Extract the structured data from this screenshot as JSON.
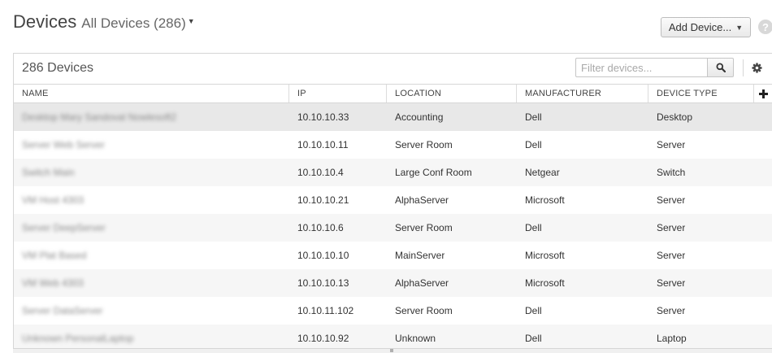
{
  "header": {
    "title": "Devices",
    "view_label": "All Devices (286)",
    "add_button": "Add Device...",
    "help_glyph": "?"
  },
  "toolbar": {
    "count_label": "286 Devices",
    "filter_placeholder": "Filter devices..."
  },
  "columns": [
    "NAME",
    "IP",
    "LOCATION",
    "MANUFACTURER",
    "DEVICE TYPE"
  ],
  "rows": [
    {
      "name": "Desktop Mary Sandoval Nowlesoft2",
      "ip": "10.10.10.33",
      "location": "Accounting",
      "manufacturer": "Dell",
      "device_type": "Desktop"
    },
    {
      "name": "Server Web Server",
      "ip": "10.10.10.11",
      "location": "Server Room",
      "manufacturer": "Dell",
      "device_type": "Server"
    },
    {
      "name": "Switch Main",
      "ip": "10.10.10.4",
      "location": "Large Conf Room",
      "manufacturer": "Netgear",
      "device_type": "Switch"
    },
    {
      "name": "VM Host 4303",
      "ip": "10.10.10.21",
      "location": "AlphaServer",
      "manufacturer": "Microsoft",
      "device_type": "Server"
    },
    {
      "name": "Server DeepServer",
      "ip": "10.10.10.6",
      "location": "Server Room",
      "manufacturer": "Dell",
      "device_type": "Server"
    },
    {
      "name": "VM Plat Based",
      "ip": "10.10.10.10",
      "location": "MainServer",
      "manufacturer": "Microsoft",
      "device_type": "Server"
    },
    {
      "name": "VM Web 4303",
      "ip": "10.10.10.13",
      "location": "AlphaServer",
      "manufacturer": "Microsoft",
      "device_type": "Server"
    },
    {
      "name": "Server DataServer",
      "ip": "10.10.11.102",
      "location": "Server Room",
      "manufacturer": "Dell",
      "device_type": "Server"
    },
    {
      "name": "Unknown PersonalLaptop",
      "ip": "10.10.10.92",
      "location": "Unknown",
      "manufacturer": "Dell",
      "device_type": "Laptop"
    }
  ],
  "icons": {
    "search": "search-icon",
    "settings": "gear-icon",
    "add_column": "plus-icon",
    "help": "help-icon",
    "dropdown": "caret-down-icon"
  },
  "colors": {
    "selected_row": "#e8e8e8",
    "alt_row": "#f6f6f6",
    "border": "#d6d6d6"
  }
}
